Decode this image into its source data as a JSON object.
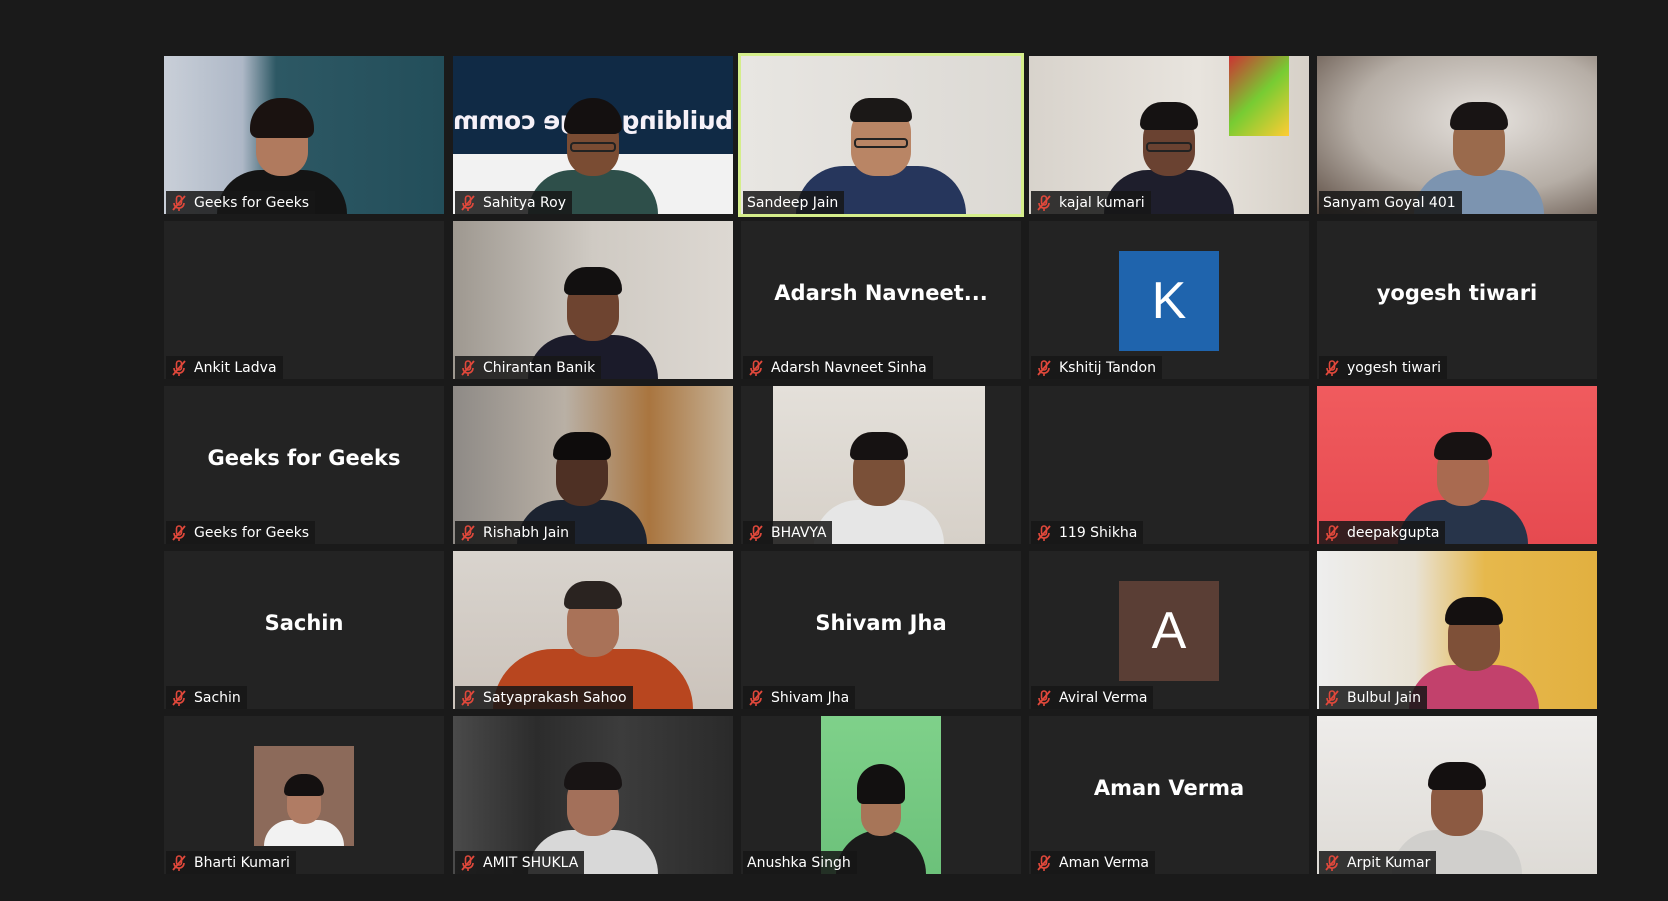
{
  "colors": {
    "background": "#1a1a1a",
    "tile": "#232323",
    "active_speaker_border": "#d5ee8b",
    "muted_mic": "#e0483b",
    "avatar_k": "#1f64ad",
    "avatar_a": "#5a3e35"
  },
  "tiles": [
    {
      "name": "Geeks for Geeks",
      "kind": "video",
      "muted": true
    },
    {
      "name": "Sahitya Roy",
      "kind": "video",
      "muted": true,
      "banner_text": "building large community"
    },
    {
      "name": "Sandeep Jain",
      "kind": "video",
      "muted": false,
      "active": true
    },
    {
      "name": "kajal kumari",
      "kind": "video",
      "muted": true
    },
    {
      "name": "Sanyam Goyal 401",
      "kind": "video",
      "muted": false
    },
    {
      "name": "Ankit Ladva",
      "kind": "empty",
      "muted": true
    },
    {
      "name": "Chirantan Banik",
      "kind": "video",
      "muted": true
    },
    {
      "name": "Adarsh Navneet Sinha",
      "kind": "name",
      "display": "Adarsh  Navneet...",
      "muted": true
    },
    {
      "name": "Kshitij Tandon",
      "kind": "avatar",
      "letter": "K",
      "muted": true
    },
    {
      "name": "yogesh tiwari",
      "kind": "name",
      "display": "yogesh tiwari",
      "muted": true
    },
    {
      "name": "Geeks for Geeks",
      "kind": "name",
      "display": "Geeks for Geeks",
      "muted": true
    },
    {
      "name": "Rishabh Jain",
      "kind": "video",
      "muted": true
    },
    {
      "name": "BHAVYA",
      "kind": "video",
      "muted": true
    },
    {
      "name": "119 Shikha",
      "kind": "empty",
      "muted": true
    },
    {
      "name": "deepakgupta",
      "kind": "video",
      "muted": true
    },
    {
      "name": "Sachin",
      "kind": "name",
      "display": "Sachin",
      "muted": true
    },
    {
      "name": "Satyaprakash Sahoo",
      "kind": "video",
      "muted": true
    },
    {
      "name": "Shivam Jha",
      "kind": "name",
      "display": "Shivam Jha",
      "muted": true
    },
    {
      "name": "Aviral Verma",
      "kind": "avatar",
      "letter": "A",
      "muted": true
    },
    {
      "name": "Bulbul Jain",
      "kind": "video",
      "muted": true
    },
    {
      "name": "Bharti Kumari",
      "kind": "photo",
      "muted": true
    },
    {
      "name": "AMIT SHUKLA",
      "kind": "video",
      "muted": true
    },
    {
      "name": "Anushka Singh",
      "kind": "video",
      "muted": false
    },
    {
      "name": "Aman Verma",
      "kind": "name",
      "display": "Aman Verma",
      "muted": true
    },
    {
      "name": "Arpit Kumar",
      "kind": "video",
      "muted": true
    }
  ]
}
